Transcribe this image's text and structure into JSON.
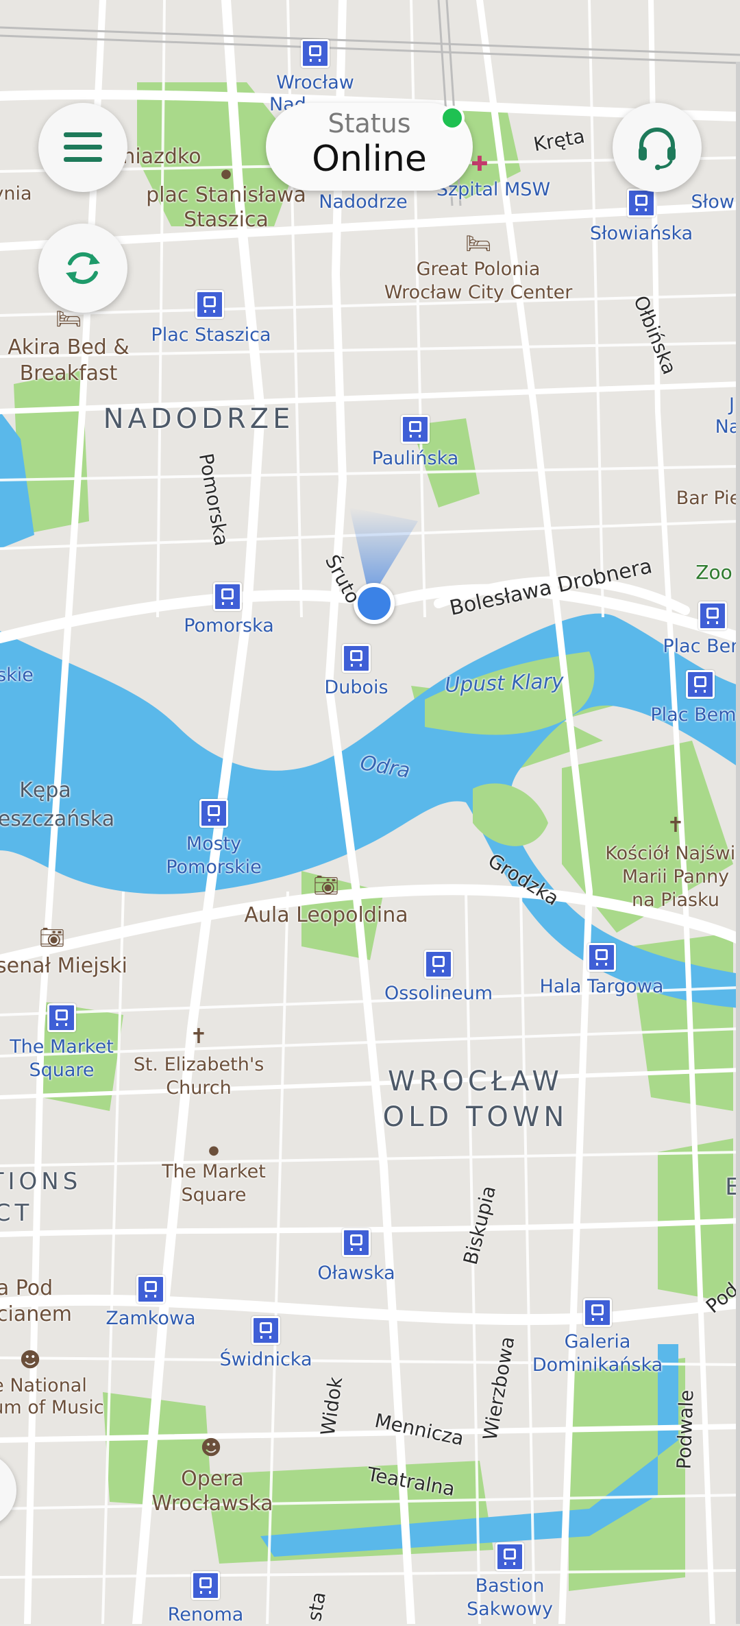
{
  "header": {
    "status_label": "Status",
    "status_value": "Online",
    "status_color": "#1fc152",
    "menu_icon": "hamburger-menu-icon",
    "support_icon": "headset-icon",
    "refresh_icon": "refresh-icon"
  },
  "map": {
    "districts": [
      "NADODRZE",
      "WROCŁAW",
      "OLD TOWN"
    ],
    "places": {
      "wroclaw_nad": "Wrocław",
      "wroclaw_nad2": "Nad",
      "nadodrze": "Nadodrze",
      "plac_staszica_square": "plac Stanisława",
      "plac_staszica_square2": "Staszica",
      "gniazdko": "niazdko",
      "ynia": "ynia",
      "szpital": "Szpital MSW",
      "kreta": "Kręta",
      "slowianska": "Słowiańska",
      "slowi": "Słowi",
      "great_polonia": "Great Polonia",
      "great_polonia2": "Wrocław City Center",
      "plac_staszica": "Plac Staszica",
      "akira": "Akira Bed &",
      "akira2": "Breakfast",
      "olbinska": "Ołbińska",
      "paulinska": "Paulińska",
      "j_na": "J",
      "j_na2": "Na",
      "bar_pie": "Bar Pie",
      "pomorska_street": "Pomorska",
      "sruto": "Śruto",
      "bolesl": "Bolesława Drobnera",
      "zoo": "Zoo",
      "pomorska": "Pomorska",
      "plac_bem1": "Plac Bem",
      "skie": "skie",
      "dubois": "Dubois",
      "upust": "Upust Klary",
      "plac_bem2": "Plac Bem",
      "kepa": "Kępa",
      "kepa2": "eszczańska",
      "odra": "Odra",
      "mosty": "Mosty",
      "mosty2": "Pomorskie",
      "kosciol": "Kościół Najświętsz",
      "kosciol2": "Marii Panny",
      "kosciol3": "na Piasku",
      "grodzka": "Grodzka",
      "aula": "Aula Leopoldina",
      "arsenal": "senał Miejski",
      "ossolineum": "Ossolineum",
      "hala": "Hala Targowa",
      "market1": "The Market",
      "market1b": "Square",
      "elizabeth": "St. Elizabeth's",
      "elizabeth2": "Church",
      "market2": "The Market",
      "market2b": "Square",
      "tions": "TIONS",
      "ct": "CT",
      "e_right": "E",
      "biskupia": "Biskupia",
      "olawska": "Oławska",
      "pod": "a Pod",
      "pod2": "cianem",
      "zamkowa": "Zamkowa",
      "galeria": "Galeria",
      "galeria2": "Dominikańska",
      "pod_right": "Pod",
      "swidnicka": "Świdnicka",
      "national": "e National",
      "national2": "um of Music",
      "widok": "Widok",
      "mennicza": "Mennicza",
      "wierzbowa": "Wierzbowa",
      "podwale": "Podwale",
      "teatralna": "Teatralna",
      "opera": "Opera",
      "opera2": "Wrocławska",
      "bastion": "Bastion",
      "bastion2": "Sakwowy",
      "renoma": "Renoma",
      "sta": "sta"
    }
  }
}
